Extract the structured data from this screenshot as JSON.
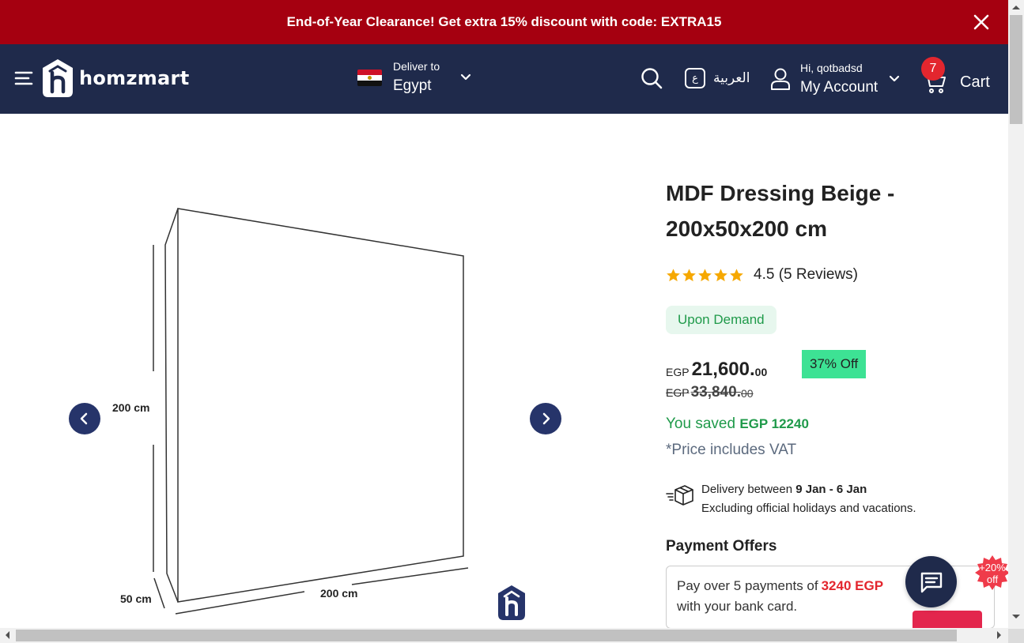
{
  "promo": {
    "text": "End-of-Year Clearance! Get extra 15% discount with code: EXTRA15",
    "close_icon": "close-icon"
  },
  "header": {
    "brand": "homzmart",
    "deliver_label": "Deliver to",
    "deliver_country": "Egypt",
    "language_badge": "ع",
    "language_label": "العربية",
    "greeting": "Hi, qotbadsd",
    "account_label": "My Account",
    "cart_count": "7",
    "cart_label": "Cart",
    "colors": {
      "bar": "#1f2a4b",
      "promo": "#a50010",
      "cart_badge": "#e3262e"
    }
  },
  "gallery": {
    "dim_height": "200 cm",
    "dim_width": "200 cm",
    "dim_depth": "50 cm"
  },
  "product": {
    "title": "MDF Dressing Beige - 200x50x200 cm",
    "rating_value": 4.5,
    "rating_text": "4.5 (5 Reviews)",
    "stock_badge": "Upon Demand",
    "currency": "EGP",
    "price_main": "21,600.",
    "price_dec": "00",
    "discount_badge": "37% Off",
    "old_price_main": "33,840.",
    "old_price_dec": "00",
    "saved_prefix": "You saved",
    "saved_amount": "EGP 12240",
    "vat_note": "*Price includes VAT",
    "delivery_prefix": "Delivery between",
    "delivery_dates": "9 Jan - 6 Jan",
    "delivery_note": "Excluding official holidays and vacations.",
    "payment_title": "Payment Offers",
    "payment_text_1": "Pay over 5 payments of",
    "payment_amount": "3240 EGP",
    "payment_text_2": "with your bank card."
  },
  "floating": {
    "promo_badge_line1": "+20%",
    "promo_badge_line2": "off"
  }
}
